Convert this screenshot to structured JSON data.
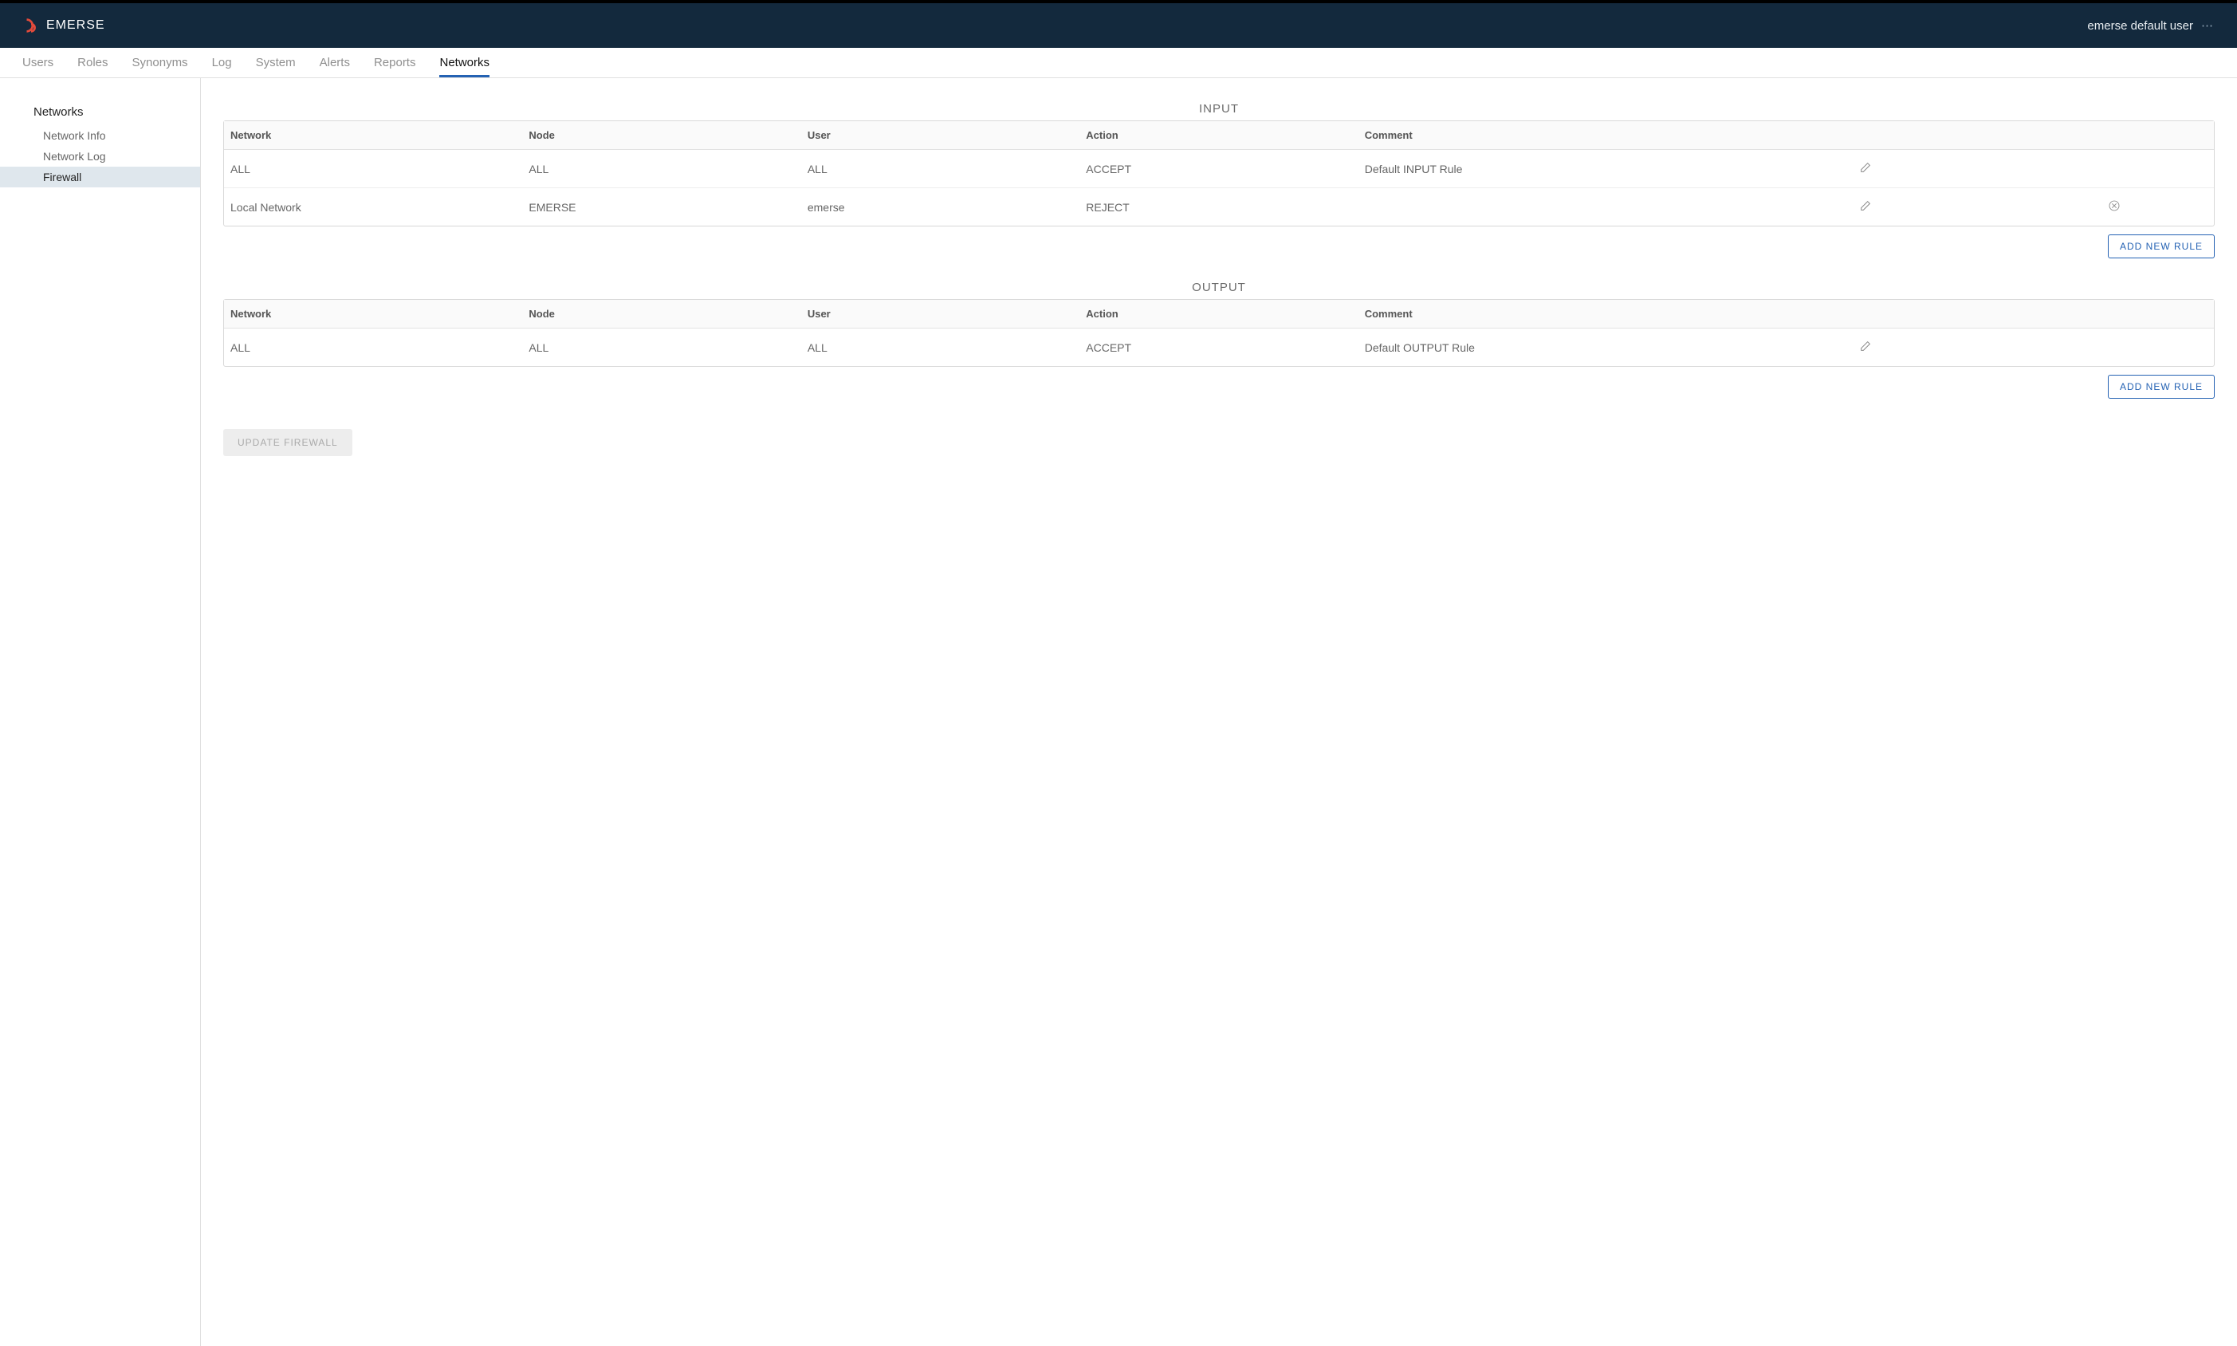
{
  "brand": "EMERSE",
  "user_name": "emerse default user",
  "nav": {
    "items": [
      {
        "label": "Users",
        "active": false
      },
      {
        "label": "Roles",
        "active": false
      },
      {
        "label": "Synonyms",
        "active": false
      },
      {
        "label": "Log",
        "active": false
      },
      {
        "label": "System",
        "active": false
      },
      {
        "label": "Alerts",
        "active": false
      },
      {
        "label": "Reports",
        "active": false
      },
      {
        "label": "Networks",
        "active": true
      }
    ]
  },
  "sidebar": {
    "heading": "Networks",
    "items": [
      {
        "label": "Network Info",
        "active": false
      },
      {
        "label": "Network Log",
        "active": false
      },
      {
        "label": "Firewall",
        "active": true
      }
    ]
  },
  "columns": {
    "network": "Network",
    "node": "Node",
    "user": "User",
    "action": "Action",
    "comment": "Comment"
  },
  "sections": {
    "input": {
      "title": "INPUT",
      "rows": [
        {
          "network": "ALL",
          "node": "ALL",
          "user": "ALL",
          "action": "ACCEPT",
          "comment": "Default INPUT Rule",
          "deletable": false
        },
        {
          "network": "Local Network",
          "node": "EMERSE",
          "user": "emerse",
          "action": "REJECT",
          "comment": "",
          "deletable": true
        }
      ],
      "add_label": "ADD NEW RULE"
    },
    "output": {
      "title": "OUTPUT",
      "rows": [
        {
          "network": "ALL",
          "node": "ALL",
          "user": "ALL",
          "action": "ACCEPT",
          "comment": "Default OUTPUT Rule",
          "deletable": false
        }
      ],
      "add_label": "ADD NEW RULE"
    }
  },
  "buttons": {
    "update_firewall": "UPDATE FIREWALL"
  }
}
